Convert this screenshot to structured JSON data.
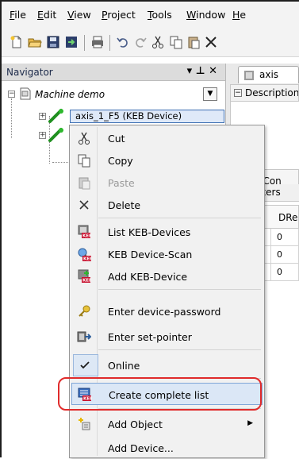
{
  "menubar": {
    "items": [
      "File",
      "Edit",
      "View",
      "Project",
      "Tools",
      "Window",
      "He"
    ]
  },
  "toolbar": {
    "icons": [
      "new-icon",
      "open-icon",
      "save-icon",
      "import-icon",
      "print-icon",
      "undo-icon",
      "redo-icon",
      "cut-icon",
      "copy-icon",
      "paste-icon",
      "delete-icon"
    ]
  },
  "navigator": {
    "title": "Navigator",
    "controls": "▾  ⊥  ✕",
    "root_label": "Machine demo",
    "device_label": "axis_1_F5 (KEB Device)"
  },
  "editor": {
    "tab_label": "axis",
    "description_label": "Description",
    "source_button": "rce Con",
    "params_tab": "ameters",
    "column_header": "DRe",
    "rows": [
      "0",
      "0",
      "0"
    ]
  },
  "context_menu": {
    "items": {
      "cut": "Cut",
      "copy": "Copy",
      "paste": "Paste",
      "delete": "Delete",
      "list_keb": "List KEB-Devices",
      "scan": "KEB Device-Scan",
      "add_keb": "Add KEB-Device",
      "password": "Enter device-password",
      "setpointer": "Enter set-pointer",
      "online": "Online",
      "complete_list": "Create complete list",
      "add_object": "Add Object",
      "add_device": "Add Device..."
    }
  },
  "colors": {
    "highlight_ring": "#e02b2b",
    "selection": "#dbe7f6",
    "keb_badge": "#c8102e"
  }
}
